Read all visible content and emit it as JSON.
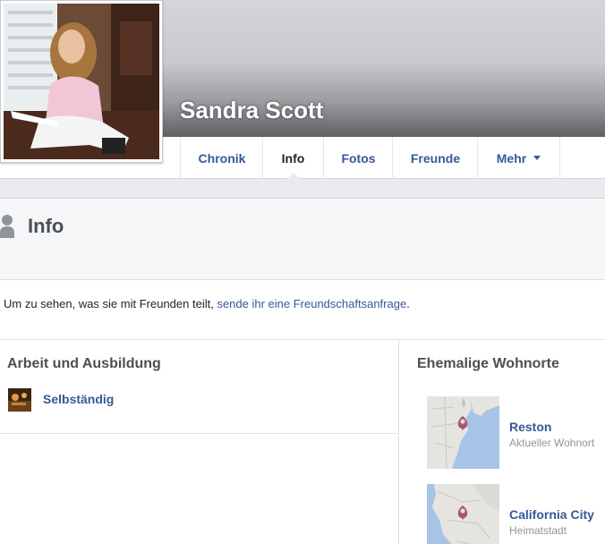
{
  "profile": {
    "name": "Sandra Scott"
  },
  "tabs": [
    {
      "label": "Chronik"
    },
    {
      "label": "Info"
    },
    {
      "label": "Fotos"
    },
    {
      "label": "Freunde"
    },
    {
      "label": "Mehr"
    }
  ],
  "info": {
    "title": "Info",
    "notice_prefix": "Um zu sehen, was sie mit Freunden teilt, ",
    "notice_link": "sende ihr eine Freundschaftsanfrage",
    "notice_suffix": "."
  },
  "work": {
    "title": "Arbeit und Ausbildung",
    "items": [
      {
        "label": "Selbständig"
      }
    ]
  },
  "places": {
    "title": "Ehemalige Wohnorte",
    "items": [
      {
        "name": "Reston",
        "type": "Aktueller Wohnort"
      },
      {
        "name": "California City",
        "type": "Heimatstadt"
      }
    ]
  },
  "colors": {
    "link": "#365899",
    "pin": "#a8566c"
  }
}
